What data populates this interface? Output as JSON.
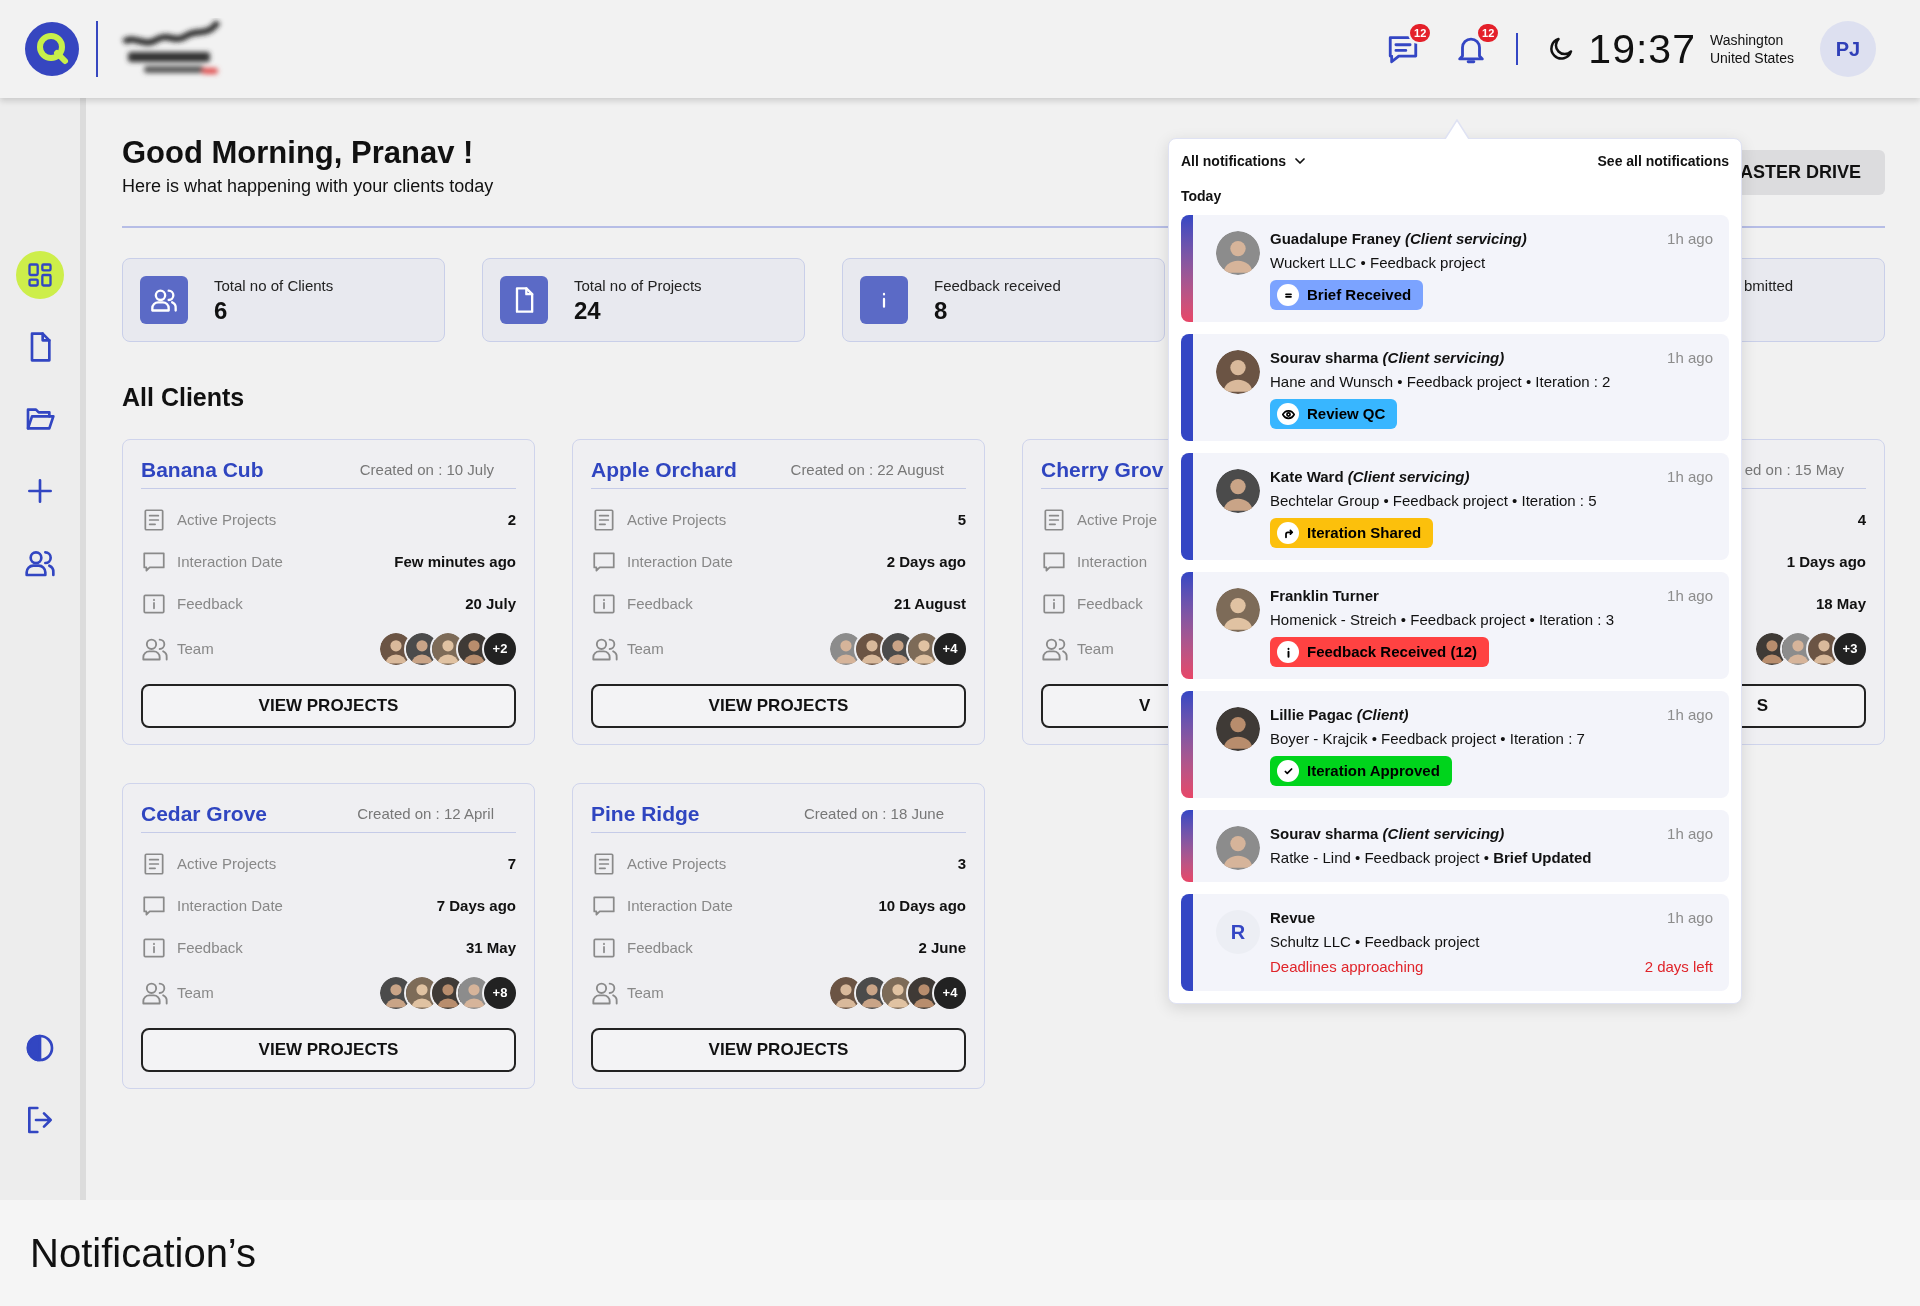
{
  "header": {
    "alerts": [
      {
        "kind": "chat",
        "count": "12"
      },
      {
        "kind": "bell",
        "count": "12"
      }
    ],
    "time": "19:37",
    "location": [
      "Washington",
      "United States"
    ],
    "user_initials": "PJ"
  },
  "sidebar": {
    "items": [
      {
        "kind": "dashboard",
        "selected": true
      },
      {
        "kind": "document",
        "selected": false
      },
      {
        "kind": "folder",
        "selected": false
      },
      {
        "kind": "add",
        "selected": false
      },
      {
        "kind": "people",
        "selected": false
      }
    ],
    "bottom": [
      {
        "kind": "contrast"
      },
      {
        "kind": "logout"
      }
    ]
  },
  "greeting": {
    "title": "Good Morning, Pranav !",
    "subtitle": "Here is what happening with your clients today",
    "button": "ASTER DRIVE"
  },
  "stats": [
    {
      "kind": "people",
      "label": "Total no of Clients",
      "value": "6"
    },
    {
      "kind": "document",
      "label": "Total no of Projects",
      "value": "24"
    },
    {
      "kind": "info",
      "label": "Feedback received",
      "value": "8"
    },
    {
      "kind": "covered",
      "label": "bmitted"
    }
  ],
  "clients_title": "All Clients",
  "clients": [
    {
      "name": "Banana Cub",
      "created": "Created on : 10 July",
      "rows": [
        {
          "kind": "projects",
          "label": "Active Projects",
          "value": "2"
        },
        {
          "kind": "interaction",
          "label": "Interaction Date",
          "value": "Few minutes ago"
        },
        {
          "kind": "feedback",
          "label": "Feedback",
          "value": "20 July"
        }
      ],
      "team": {
        "label": "Team",
        "more": "+2"
      },
      "button": [
        "VIEW PROJECTS"
      ]
    },
    {
      "name": "Apple Orchard",
      "created": "Created on : 22 August",
      "rows": [
        {
          "kind": "projects",
          "label": "Active Projects",
          "value": "5"
        },
        {
          "kind": "interaction",
          "label": "Interaction Date",
          "value": "2 Days ago"
        },
        {
          "kind": "feedback",
          "label": "Feedback",
          "value": "21 August"
        }
      ],
      "team": {
        "label": "Team",
        "more": "+4"
      },
      "button": [
        "VIEW PROJECTS"
      ]
    },
    {
      "name": "Cherry Grov",
      "created": "ed on : 15 May",
      "rows": [
        {
          "kind": "projects",
          "label": "Active Proje",
          "value": "4"
        },
        {
          "kind": "interaction",
          "label": "Interaction",
          "value": "1 Days ago"
        },
        {
          "kind": "feedback",
          "label": "Feedback",
          "value": "18 May"
        }
      ],
      "team": {
        "label": "Team",
        "more": "+3"
      },
      "button": [
        "V",
        "S"
      ]
    },
    {
      "name": "Cedar Grove",
      "created": "Created on : 12 April",
      "rows": [
        {
          "kind": "projects",
          "label": "Active Projects",
          "value": "7"
        },
        {
          "kind": "interaction",
          "label": "Interaction Date",
          "value": "7 Days ago"
        },
        {
          "kind": "feedback",
          "label": "Feedback",
          "value": "31 May"
        }
      ],
      "team": {
        "label": "Team",
        "more": "+8"
      },
      "button": [
        "VIEW PROJECTS"
      ]
    },
    {
      "name": "Pine Ridge",
      "created": "Created on : 18 June",
      "rows": [
        {
          "kind": "projects",
          "label": "Active Projects",
          "value": "3"
        },
        {
          "kind": "interaction",
          "label": "Interaction Date",
          "value": "10 Days ago"
        },
        {
          "kind": "feedback",
          "label": "Feedback",
          "value": "2 June"
        }
      ],
      "team": {
        "label": "Team",
        "more": "+4"
      },
      "button": [
        "VIEW PROJECTS"
      ]
    }
  ],
  "notifications": {
    "filter": "All notifications",
    "see_all": "See all notifications",
    "section": "Today",
    "items": [
      {
        "unread": true,
        "name": "Guadalupe Franey",
        "role": "(Client servicing)",
        "time": "1h ago",
        "detail": "Wuckert LLC • Feedback project",
        "badge": {
          "kind": "brief",
          "label": "Brief Received",
          "color": "#7ba3ff"
        }
      },
      {
        "unread": false,
        "name": "Sourav sharma",
        "role": "(Client servicing)",
        "time": "1h ago",
        "detail": "Hane and Wunsch • Feedback project • Iteration : 2",
        "badge": {
          "kind": "review",
          "label": "Review QC",
          "color": "#38b6ff"
        }
      },
      {
        "unread": false,
        "name": "Kate Ward",
        "role": "(Client servicing)",
        "time": "1h ago",
        "detail": "Bechtelar Group • Feedback project • Iteration : 5",
        "badge": {
          "kind": "shared",
          "label": "Iteration Shared",
          "color": "#fcc00c"
        }
      },
      {
        "unread": true,
        "name": "Franklin Turner",
        "time": "1h ago",
        "detail": "Homenick - Streich • Feedback project • Iteration : 3",
        "badge": {
          "kind": "feedback",
          "label": "Feedback Received (12)",
          "color": "#ff4242"
        }
      },
      {
        "unread": true,
        "name": "Lillie Pagac",
        "role": "(Client)",
        "time": "1h ago",
        "detail": "Boyer - Krajcik • Feedback project • Iteration : 7",
        "badge": {
          "kind": "approved",
          "label": "Iteration Approved",
          "color": "#00d41c"
        }
      },
      {
        "unread": true,
        "name": "Sourav sharma",
        "role": "(Client servicing)",
        "time": "1h ago",
        "detail": "Ratke - Lind • Feedback project • **Brief Updated**"
      },
      {
        "unread": false,
        "initial": "R",
        "name": "Revue",
        "time": "1h ago",
        "detail": "Schultz LLC • Feedback project",
        "alert": "Deadlines approaching",
        "due": "2 days left"
      }
    ]
  },
  "footer": {
    "caption": "Notification’s"
  }
}
